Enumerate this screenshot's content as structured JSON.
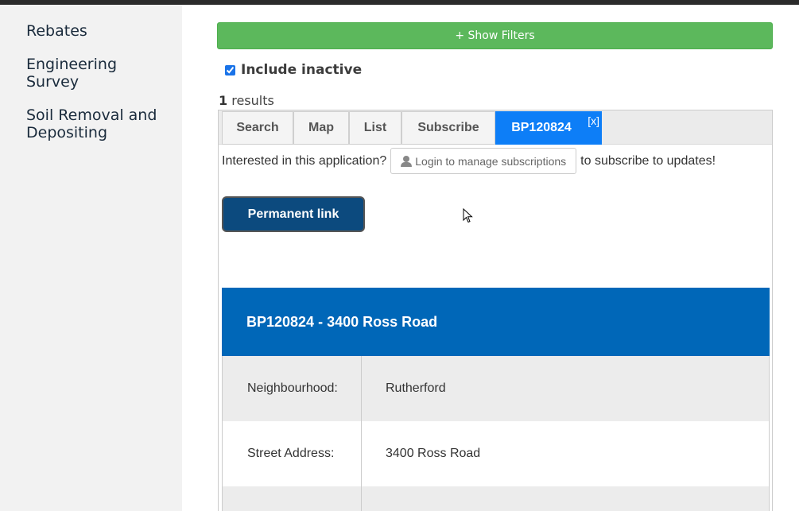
{
  "sidebar": {
    "items": [
      {
        "label": "Rebates"
      },
      {
        "label": "Engineering Survey"
      },
      {
        "label": "Soil Removal and Depositing"
      }
    ]
  },
  "filters": {
    "show_filters_label": "+ Show Filters",
    "include_inactive_label": "Include inactive",
    "include_inactive_checked": true
  },
  "results": {
    "count": "1",
    "label": "results"
  },
  "tabs": [
    {
      "label": "Search"
    },
    {
      "label": "Map"
    },
    {
      "label": "List"
    },
    {
      "label": "Subscribe"
    },
    {
      "label": "BP120824",
      "active": true,
      "close_label": "[x]"
    }
  ],
  "subscribe": {
    "prefix": "Interested in this application?",
    "login_button_label": "Login to manage subscriptions",
    "suffix": "to subscribe to updates!"
  },
  "permanent_link_label": "Permanent link",
  "detail": {
    "title": "BP120824 - 3400 Ross Road",
    "rows": [
      {
        "key": "Neighbourhood:",
        "value": "Rutherford"
      },
      {
        "key": "Street Address:",
        "value": "3400 Ross Road"
      }
    ]
  },
  "colors": {
    "show_filters_bg": "#5cb85c",
    "active_tab": "#0d7ef7",
    "permanent_link_bg": "#0c4a7e",
    "detail_header_bg": "#0067b8"
  }
}
